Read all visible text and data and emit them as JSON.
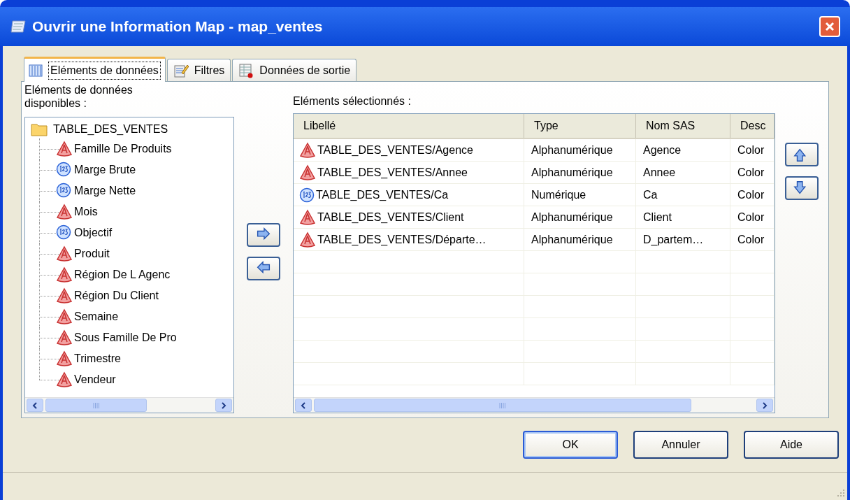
{
  "window": {
    "title": "Ouvrir une Information Map - map_ventes"
  },
  "tabs": [
    {
      "label": "Eléments de données",
      "selected": true
    },
    {
      "label": "Filtres",
      "selected": false
    },
    {
      "label": "Données de sortie",
      "selected": false
    }
  ],
  "available": {
    "label": "Eléments de données disponibles :",
    "tree": [
      {
        "label": "TABLE_DES_VENTES",
        "children": [
          {
            "label": "Famille De Produits",
            "kind": "text"
          },
          {
            "label": "Marge Brute",
            "kind": "number"
          },
          {
            "label": "Marge Nette",
            "kind": "number"
          },
          {
            "label": "Mois",
            "kind": "text"
          },
          {
            "label": "Objectif",
            "kind": "number"
          },
          {
            "label": "Produit",
            "kind": "text"
          },
          {
            "label": "Région De L Agenc",
            "kind": "text"
          },
          {
            "label": "Région Du Client",
            "kind": "text"
          },
          {
            "label": "Semaine",
            "kind": "text"
          },
          {
            "label": "Sous Famille De Pro",
            "kind": "text"
          },
          {
            "label": "Trimestre",
            "kind": "text"
          },
          {
            "label": "Vendeur",
            "kind": "text"
          }
        ]
      }
    ]
  },
  "selected_items": {
    "label": "Eléments sélectionnés :",
    "table": {
      "columns": [
        "Libellé",
        "Type",
        "Nom SAS",
        "Desc"
      ],
      "rows": [
        {
          "kind": "text",
          "cells": [
            "TABLE_DES_VENTES/Agence",
            "Alphanumérique",
            "Agence",
            "Color"
          ]
        },
        {
          "kind": "text",
          "cells": [
            "TABLE_DES_VENTES/Annee",
            "Alphanumérique",
            "Annee",
            "Color"
          ]
        },
        {
          "kind": "number",
          "cells": [
            "TABLE_DES_VENTES/Ca",
            "Numérique",
            "Ca",
            "Color"
          ]
        },
        {
          "kind": "text",
          "cells": [
            "TABLE_DES_VENTES/Client",
            "Alphanumérique",
            "Client",
            "Color"
          ]
        },
        {
          "kind": "text",
          "cells": [
            "TABLE_DES_VENTES/Départe…",
            "Alphanumérique",
            "D_partem…",
            "Color"
          ]
        }
      ]
    }
  },
  "buttons": [
    {
      "label": "OK",
      "default": true
    },
    {
      "label": "Annuler",
      "default": false
    },
    {
      "label": "Aide",
      "default": false
    }
  ]
}
